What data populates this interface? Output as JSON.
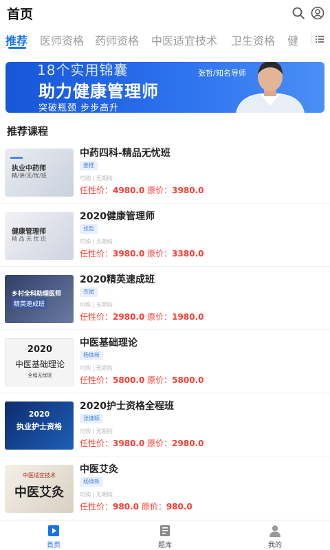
{
  "header": {
    "title": "首页",
    "search_icon": "search-icon",
    "user_icon": "user-circle-icon"
  },
  "tabs": [
    {
      "label": "推荐",
      "active": true
    },
    {
      "label": "医师资格",
      "active": false
    },
    {
      "label": "药师资格",
      "active": false
    },
    {
      "label": "中医适宜技术",
      "active": false
    },
    {
      "label": "卫生资格",
      "active": false
    },
    {
      "label": "健",
      "active": false
    }
  ],
  "tabs_more_icon": "menu-icon",
  "banner": {
    "line1": "18个实用锦囊",
    "line2": "助力健康管理师",
    "line3": "突破瓶颈 步步高升",
    "mentor_name": "张哲/",
    "mentor_title": "知名导师"
  },
  "section_title": "推荐课程",
  "courses": [
    {
      "title": "中药四科-精品无忧班",
      "tag": "姜推",
      "sub": "可购 | 无期购",
      "price_label": "任性价：",
      "price": "4980.0",
      "orig_label": "原价：",
      "orig": "3980.0",
      "thumb_line1": "执业中药师",
      "thumb_line2": "精/讲/无/忧/班"
    },
    {
      "title": "2020健康管理师",
      "tag": "张哲",
      "sub": "可购 | 无期购",
      "price_label": "任性价：",
      "price": "3980.0",
      "orig_label": "原价：",
      "orig": "3380.0",
      "thumb_line1": "健康管理师",
      "thumb_line2": "精 品 无 忧 班"
    },
    {
      "title": "2020精英速成班",
      "tag": "衣斌",
      "sub": "可购 | 无期购",
      "price_label": "任性价：",
      "price": "2980.0",
      "orig_label": "原价：",
      "orig": "1980.0",
      "thumb_line1": "乡村全科助理医师",
      "thumb_line2": "精英速成班"
    },
    {
      "title": "中医基础理论",
      "tag": "杨焕新",
      "sub": "可购 | 无期购",
      "price_label": "任性价：",
      "price": "5800.0",
      "orig_label": "原价：",
      "orig": "5800.0",
      "thumb_line1": "2020",
      "thumb_line2": "中医基础理论",
      "thumb_line3": "全程无忧班"
    },
    {
      "title": "2020护士资格全程班",
      "tag": "张谦颖",
      "sub": "可购 | 无期购",
      "price_label": "任性价：",
      "price": "3980.0",
      "orig_label": "原价：",
      "orig": "2980.0",
      "thumb_line1": "2020",
      "thumb_line2": "执业护士资格"
    },
    {
      "title": "中医艾灸",
      "tag": "杨焕新",
      "sub": "可购 | 无期购",
      "price_label": "任性价：",
      "price": "980.0",
      "orig_label": "原价：",
      "orig": "980.0",
      "thumb_line1": "中医适宜技术",
      "thumb_line2": "中医艾灸"
    }
  ],
  "bottom_nav": [
    {
      "label": "首页",
      "icon": "home-play-icon",
      "active": true
    },
    {
      "label": "题库",
      "icon": "question-bank-icon",
      "active": false
    },
    {
      "label": "我的",
      "icon": "profile-icon",
      "active": false
    }
  ],
  "colors": {
    "accent": "#1a73e8",
    "price": "#ff3b30",
    "tag_text": "#4a86e8",
    "tag_bg": "#e8f0fe"
  }
}
